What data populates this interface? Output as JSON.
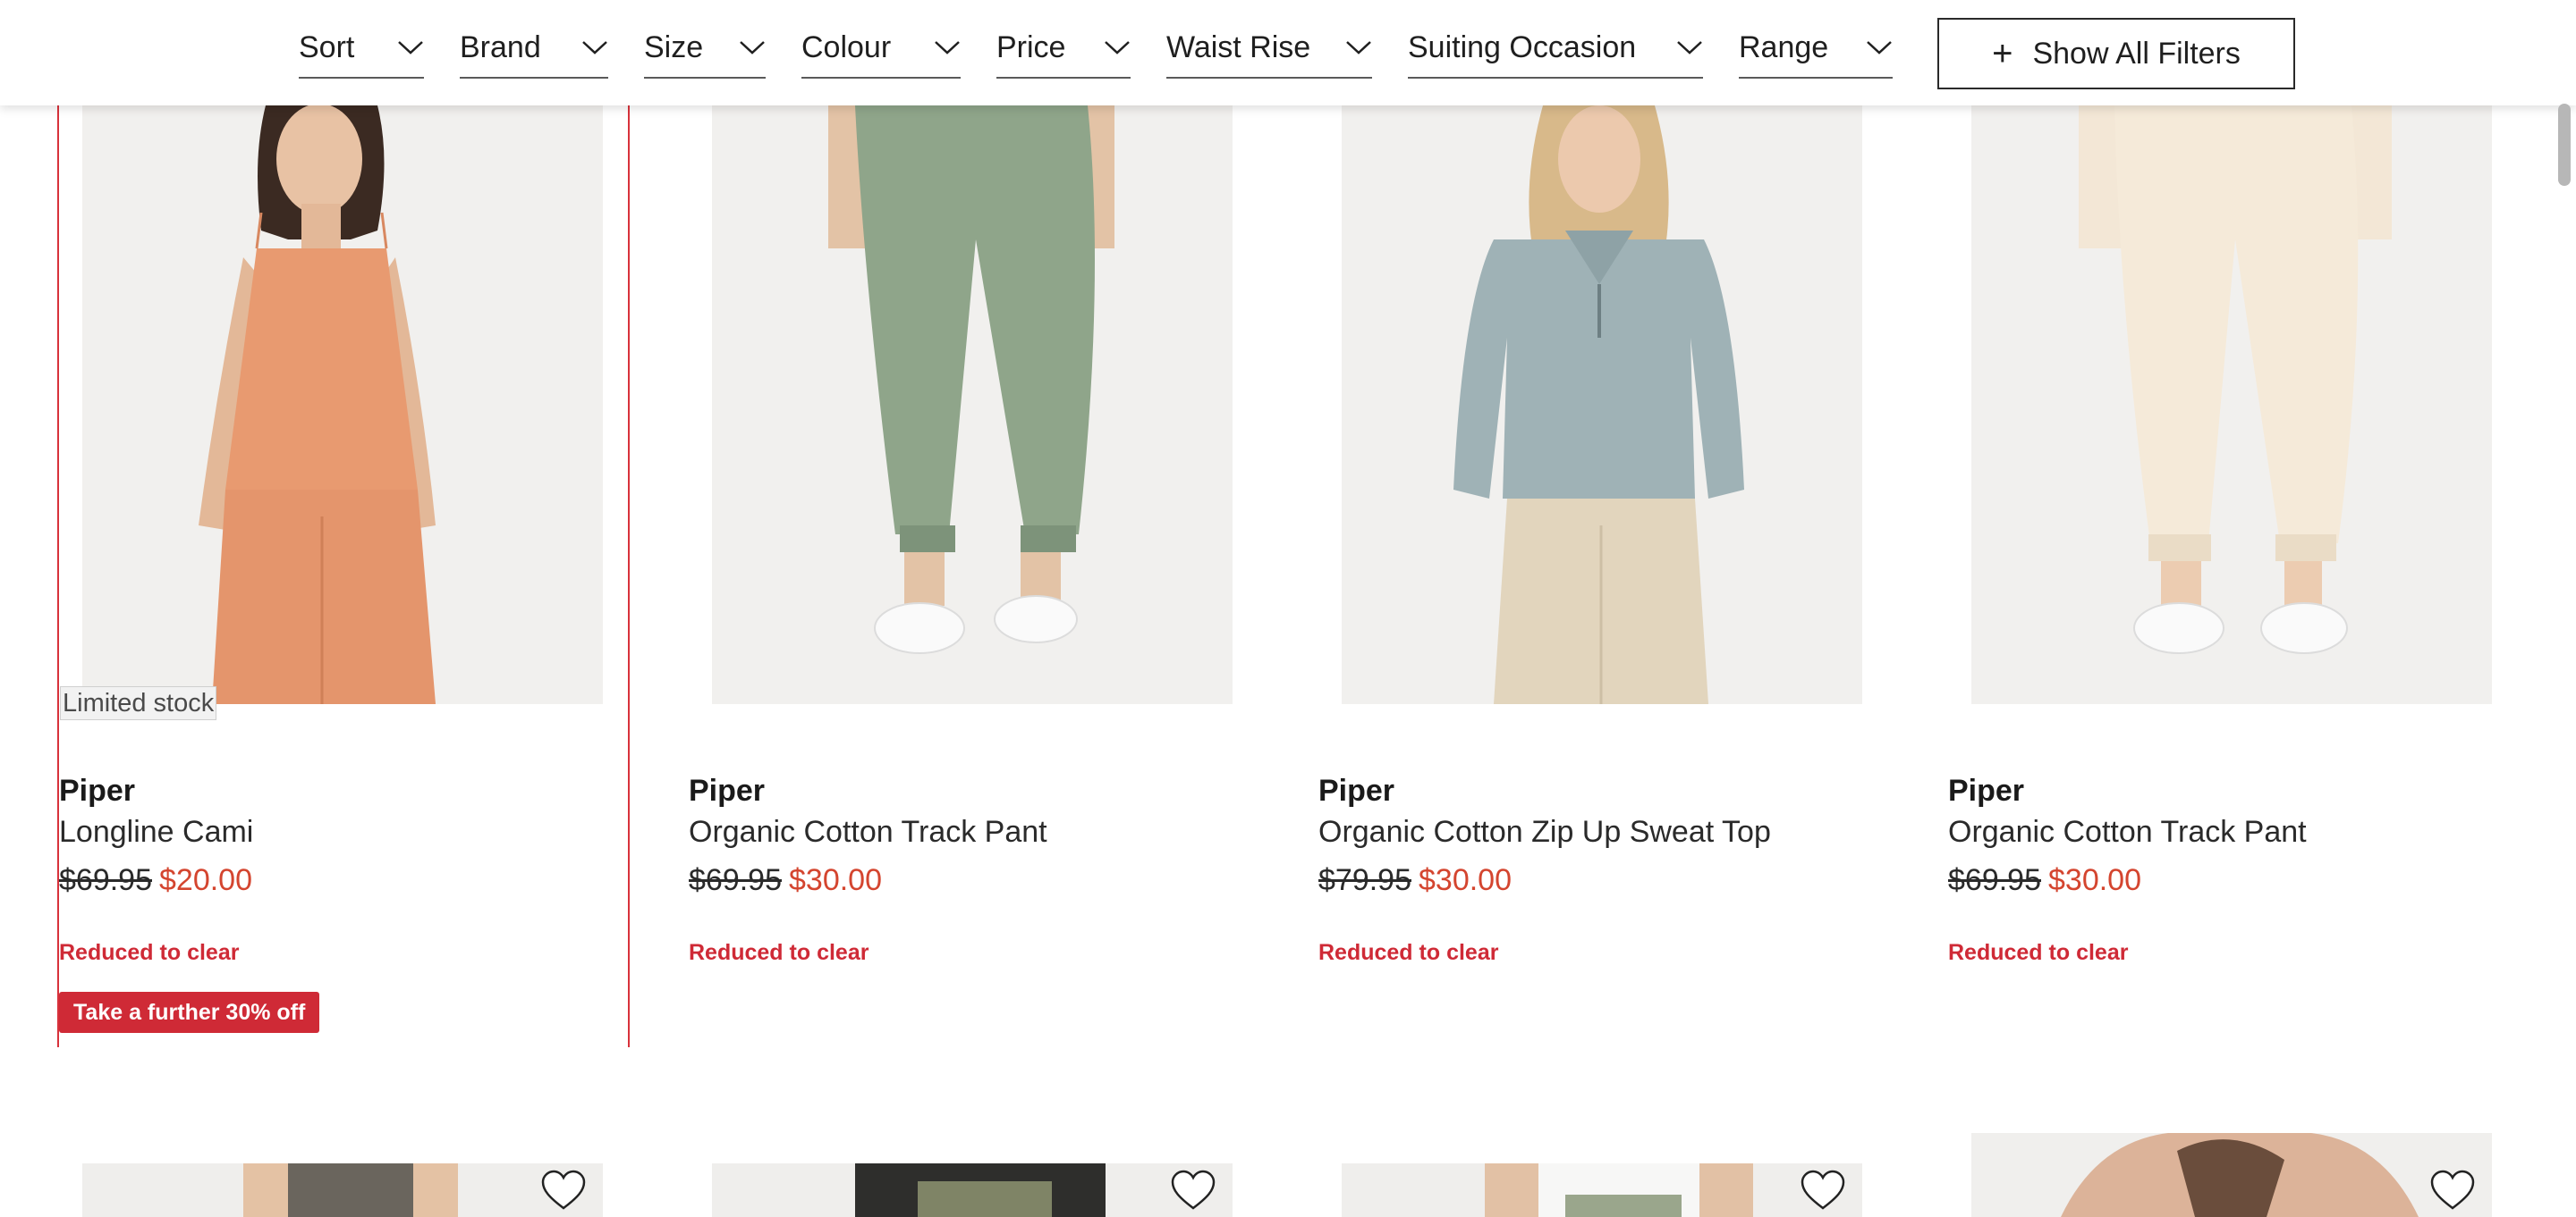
{
  "filters": [
    {
      "label": "Sort"
    },
    {
      "label": "Brand"
    },
    {
      "label": "Size"
    },
    {
      "label": "Colour"
    },
    {
      "label": "Price"
    },
    {
      "label": "Waist Rise"
    },
    {
      "label": "Suiting Occasion"
    },
    {
      "label": "Range"
    }
  ],
  "show_all_filters": {
    "label": "Show All Filters",
    "icon": "plus-icon"
  },
  "products": [
    {
      "brand": "Piper",
      "name": "Longline Cami",
      "was_price": "$69.95",
      "now_price": "$20.00",
      "promo": "Reduced to clear",
      "badge": "Take a further 30% off",
      "stock_label": "Limited stock",
      "image": "woman in peach linen cami and pants",
      "selected": true
    },
    {
      "brand": "Piper",
      "name": "Organic Cotton Track Pant",
      "was_price": "$69.95",
      "now_price": "$30.00",
      "promo": "Reduced to clear",
      "image": "sage green track pants with white sneakers"
    },
    {
      "brand": "Piper",
      "name": "Organic Cotton Zip Up Sweat Top",
      "was_price": "$79.95",
      "now_price": "$30.00",
      "promo": "Reduced to clear",
      "image": "woman in blue-grey half-zip sweat top"
    },
    {
      "brand": "Piper",
      "name": "Organic Cotton Track Pant",
      "was_price": "$69.95",
      "now_price": "$30.00",
      "promo": "Reduced to clear",
      "image": "cream track pants with white sneakers"
    }
  ],
  "row2": [
    {
      "wishlist_icon": "heart-icon"
    },
    {
      "wishlist_icon": "heart-icon"
    },
    {
      "wishlist_icon": "heart-icon"
    },
    {
      "wishlist_icon": "heart-icon"
    }
  ],
  "colors": {
    "sale": "#d4452f",
    "promo": "#cf2a36",
    "selection": "#d8323b"
  }
}
